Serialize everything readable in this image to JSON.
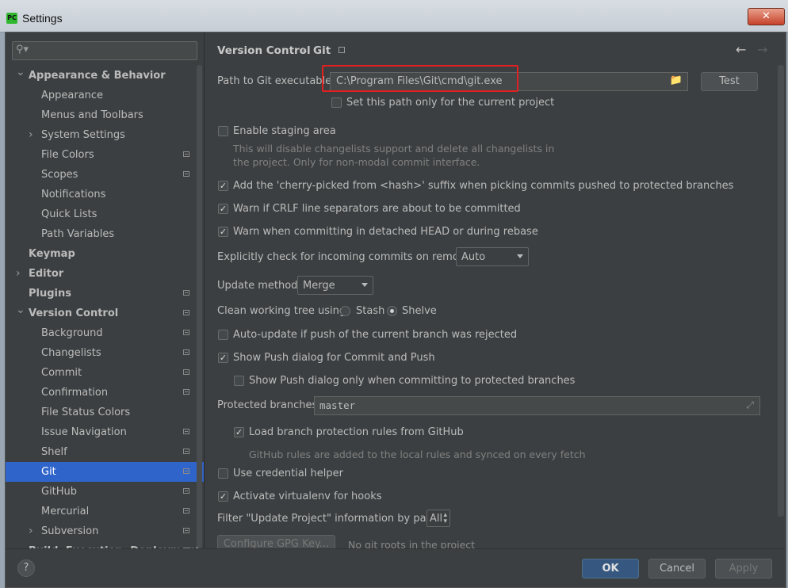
{
  "window": {
    "title": "Settings",
    "close_label": "✕",
    "app_icon_text": "PC"
  },
  "search": {
    "placeholder": ""
  },
  "sidebar": {
    "items": [
      {
        "label": "Appearance & Behavior",
        "level": 0,
        "bold": true,
        "arrow": "down",
        "project": false
      },
      {
        "label": "Appearance",
        "level": 1,
        "bold": false,
        "arrow": "",
        "project": false
      },
      {
        "label": "Menus and Toolbars",
        "level": 1,
        "bold": false,
        "arrow": "",
        "project": false
      },
      {
        "label": "System Settings",
        "level": 1,
        "bold": false,
        "arrow": "right",
        "project": false
      },
      {
        "label": "File Colors",
        "level": 1,
        "bold": false,
        "arrow": "",
        "project": true
      },
      {
        "label": "Scopes",
        "level": 1,
        "bold": false,
        "arrow": "",
        "project": true
      },
      {
        "label": "Notifications",
        "level": 1,
        "bold": false,
        "arrow": "",
        "project": false
      },
      {
        "label": "Quick Lists",
        "level": 1,
        "bold": false,
        "arrow": "",
        "project": false
      },
      {
        "label": "Path Variables",
        "level": 1,
        "bold": false,
        "arrow": "",
        "project": false
      },
      {
        "label": "Keymap",
        "level": 0,
        "bold": true,
        "arrow": "",
        "project": false
      },
      {
        "label": "Editor",
        "level": 0,
        "bold": true,
        "arrow": "right",
        "project": false
      },
      {
        "label": "Plugins",
        "level": 0,
        "bold": true,
        "arrow": "",
        "project": true
      },
      {
        "label": "Version Control",
        "level": 0,
        "bold": true,
        "arrow": "down",
        "project": true
      },
      {
        "label": "Background",
        "level": 1,
        "bold": false,
        "arrow": "",
        "project": true
      },
      {
        "label": "Changelists",
        "level": 1,
        "bold": false,
        "arrow": "",
        "project": true
      },
      {
        "label": "Commit",
        "level": 1,
        "bold": false,
        "arrow": "",
        "project": true
      },
      {
        "label": "Confirmation",
        "level": 1,
        "bold": false,
        "arrow": "",
        "project": true
      },
      {
        "label": "File Status Colors",
        "level": 1,
        "bold": false,
        "arrow": "",
        "project": false
      },
      {
        "label": "Issue Navigation",
        "level": 1,
        "bold": false,
        "arrow": "",
        "project": true
      },
      {
        "label": "Shelf",
        "level": 1,
        "bold": false,
        "arrow": "",
        "project": true
      },
      {
        "label": "Git",
        "level": 1,
        "bold": false,
        "arrow": "",
        "project": true,
        "selected": true
      },
      {
        "label": "GitHub",
        "level": 1,
        "bold": false,
        "arrow": "",
        "project": true
      },
      {
        "label": "Mercurial",
        "level": 1,
        "bold": false,
        "arrow": "",
        "project": true
      },
      {
        "label": "Subversion",
        "level": 1,
        "bold": false,
        "arrow": "right",
        "project": true
      },
      {
        "label": "Build, Execution, Deployment",
        "level": 0,
        "bold": true,
        "arrow": "right",
        "project": true
      }
    ]
  },
  "breadcrumb": {
    "parent": "Version Control",
    "separator": "›",
    "current": "Git",
    "back": "←",
    "forward": "→"
  },
  "git": {
    "path_label": "Path to Git executable:",
    "path_value": "C:\\Program Files\\Git\\cmd\\git.exe",
    "test_button": "Test",
    "path_project_only": "Set this path only for the current project",
    "staging_label": "Enable staging area",
    "staging_hint_1": "This will disable changelists support and delete all changelists in",
    "staging_hint_2": "the project. Only for non-modal commit interface.",
    "cherry_pick": "Add the 'cherry-picked from <hash>' suffix when picking commits pushed to protected branches",
    "crlf": "Warn if CRLF line separators are about to be committed",
    "detached": "Warn when committing in detached HEAD or during rebase",
    "incoming_label": "Explicitly check for incoming commits on remotes:",
    "incoming_value": "Auto",
    "update_label": "Update method:",
    "update_value": "Merge",
    "clean_label": "Clean working tree using:",
    "stash": "Stash",
    "shelve": "Shelve",
    "auto_update": "Auto-update if push of the current branch was rejected",
    "show_push": "Show Push dialog for Commit and Push",
    "show_push_protected": "Show Push dialog only when committing to protected branches",
    "protected_label": "Protected branches:",
    "protected_value": "master",
    "load_rules": "Load branch protection rules from GitHub",
    "github_hint": "GitHub rules are added to the local rules and synced on every fetch",
    "credential": "Use credential helper",
    "virtualenv": "Activate virtualenv for hooks",
    "filter_label": "Filter \"Update Project\" information by paths:",
    "filter_value": "All",
    "gpg_button": "Configure GPG Key...",
    "gpg_hint": "No git roots in the project"
  },
  "footer": {
    "help": "?",
    "ok": "OK",
    "cancel": "Cancel",
    "apply": "Apply"
  },
  "colors": {
    "highlight_border": "#e02020",
    "selection": "#2f65ca",
    "ok_button": "#365880"
  }
}
